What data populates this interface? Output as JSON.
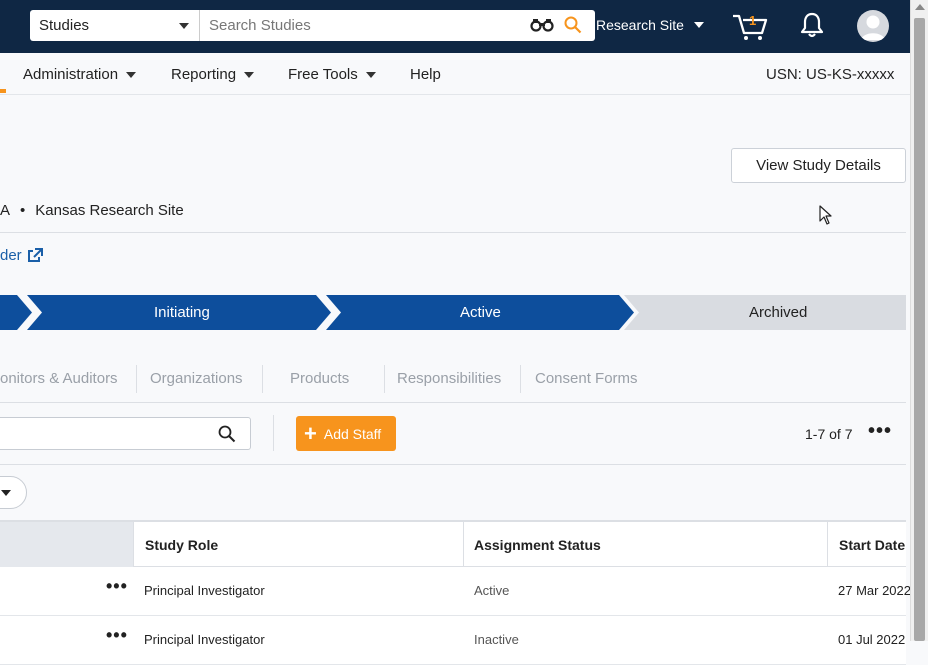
{
  "topbar": {
    "scope_label": "Studies",
    "search_placeholder": "Search Studies",
    "site_label": "Research Site",
    "cart_count": "1"
  },
  "nav": {
    "items": [
      "Administration",
      "Reporting",
      "Free Tools",
      "Help"
    ],
    "usn": "USN: US-KS-xxxxx"
  },
  "study": {
    "view_details_label": "View Study Details",
    "site_line_prefix": "A",
    "site_name": "Kansas Research Site",
    "link_text": "der"
  },
  "progress": {
    "stages": [
      "Initiating",
      "Active",
      "Archived"
    ],
    "current_stage": "Active"
  },
  "tabs": [
    "onitors & Auditors",
    "Organizations",
    "Products",
    "Responsibilities",
    "Consent Forms"
  ],
  "staff": {
    "add_label": "Add Staff",
    "pager": "1-7 of 7"
  },
  "table": {
    "columns": [
      "Study Role",
      "Assignment Status",
      "Start Date"
    ],
    "rows": [
      {
        "role": "Principal Investigator",
        "status": "Active",
        "start": "27 Mar 2022"
      },
      {
        "role": "Principal Investigator",
        "status": "Inactive",
        "start": "01 Jul 2022"
      }
    ]
  },
  "colors": {
    "topbar": "#0f2744",
    "accent": "#f7941d",
    "stage_done": "#0d4e9c",
    "stage_pending": "#d9dce1",
    "link": "#1a5fa8"
  }
}
